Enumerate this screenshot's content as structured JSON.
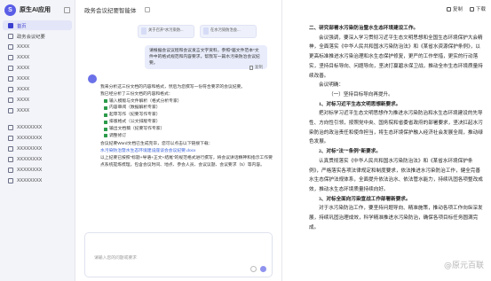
{
  "app": {
    "name": "原生AI应用"
  },
  "sidebar": {
    "items": [
      {
        "label": "首页",
        "active": true
      },
      {
        "label": "政务会议纪要"
      },
      {
        "label": "XXXX"
      },
      {
        "label": "XXXX"
      },
      {
        "label": "XXXX"
      },
      {
        "label": "XXXX"
      },
      {
        "label": "XXXX"
      },
      {
        "label": "XXXX"
      },
      {
        "label": "XXXX"
      }
    ],
    "items2": [
      "XXXXXXXX",
      "XXXXXXXX",
      "XXXXXXXX",
      "XXXXXXXX",
      "XXXXXXXX",
      "XXXXXXXX"
    ]
  },
  "chat": {
    "title": "政务会议纪要智能体",
    "attachments": [
      "关于召开*水污染防...",
      "在水污染防治会..."
    ],
    "user_message": "请根据会议议程和会议发言文字资料，参照*届文件范本*文件中的格式规范和内容要求，帮我写一篇水污染防治会议纪要。",
    "copy_label": "复制",
    "answer_lines": [
      "我来分析这三份文档的内容和格式，然后为您撰写一份符合要求的会议纪要。",
      "我已经分析了三份文档的内容和格式："
    ],
    "checklist": [
      "输入模版与文件解析（格式分析专家）",
      "内容审阅（数据解析专家）",
      "起草写作（纪要写作专家）",
      "排版格式（公文排版专家）",
      "输出文档稿（纪要写作专家）",
      "调整修订"
    ],
    "answer_tail": [
      "会议纪要Word文档已生成完毕，您可以点击以下链接下载：",
      "水污染防治暨水生态环境建设座谈会会议纪要.docx",
      "以上纪要已按照“标题+导语+正文+结尾”的规范格式进行撰写，将会议讲话精神和指示工作要点系统提炼梳理，包含会议时间、地点、参会人员、会议议题、会议要求（5）等内容。"
    ],
    "input_placeholder": "请输入您的问题或要求"
  },
  "doc": {
    "toolbar": {
      "copy": "复制",
      "download": "下载"
    },
    "heading": "二、研究部署水污染防治暨水生态环境建设工作。",
    "paragraphs": [
      "会议强调，要深入学习贯彻习近平生态文明思想和全国生态环境保护大会精神，全面落实《中华人民共和国水污染防治法》和《某省水资源保护条例》，以更高标准推进水污染治理和水生态保护修复，更严的工作举措，更实的行动落实，坚持目标导向、问题导向，坚决打赢碧水保卫战，推动全市生态环境质量持续改善。",
      "会议明确："
    ],
    "sub": "（一）坚持目标导向再提升。",
    "item1_title": "1、对标习近平生态文明思想新要求。",
    "item1_text": "把对标学习近平生态文明思想作为推进水污染防治和水生态环境建设的先导性、方向性引领，按照党中央、国务院和省委省政府的部署要求，坚决扛起水污染防治的政治责任和使命担当，将生态环境保护融入经济社会发展全局，推动绿色发展。",
    "item2_title": "2、对标“法”“条例”新要求。",
    "item2_text": "认真贯彻落实《中华人民共和国水污染防治法》和《某省水环境保护条例》，严格落实各项法律规定和制度要求，依法推进水污染防治工作，健全完善水生态保护法规体系，全面提升依法治水、依法管水能力，持续巩固各项整改成效，推动水生态环境质量持续向好。",
    "item3_title": "3、对标全面向污染宣战工作部署新要求。",
    "item3_text": "对于水污染防治工作，要坚持问题导向、精准施策，推动各项工作向纵深发展，持续巩固治理成效，科学精准推进水污染防治，确保各项目标任务圆满完成。",
    "watermark": "@原元百联"
  }
}
